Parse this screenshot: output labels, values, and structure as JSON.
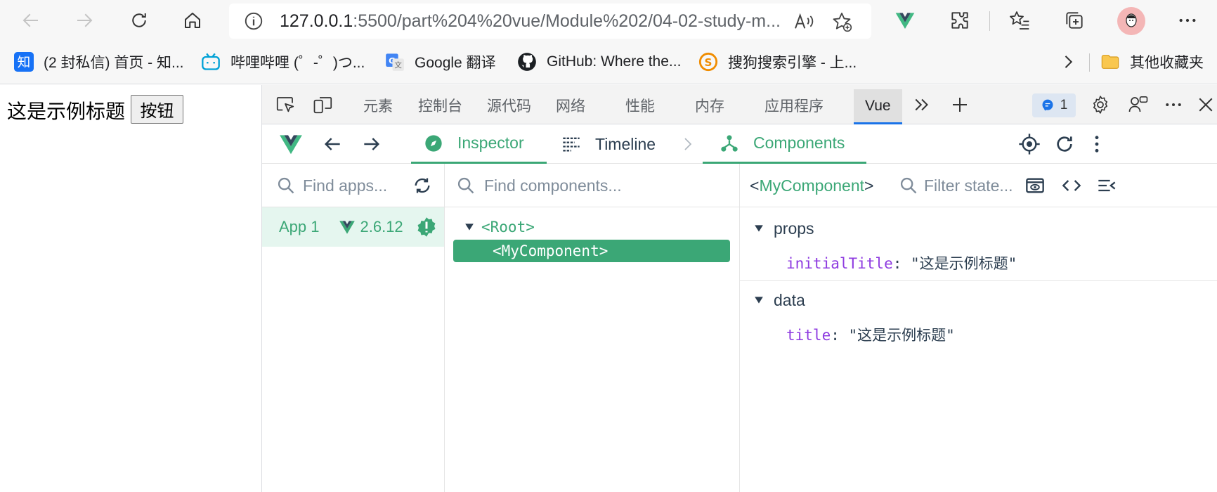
{
  "browser": {
    "url_host": "127.0.0.1",
    "url_rest": ":5500/part%204%20vue/Module%202/04-02-study-m...",
    "icons": {
      "back": "arrow-left-icon",
      "forward": "arrow-right-icon",
      "refresh": "refresh-icon",
      "home": "home-icon",
      "info": "info-icon",
      "read_aloud": "read-aloud-icon",
      "favorite": "star-plus-icon",
      "vue_ext": "vue-logo-icon",
      "extensions": "puzzle-icon",
      "favorites": "favorites-icon",
      "collections": "collections-icon",
      "profile": "avatar",
      "more": "more-icon"
    }
  },
  "bookmarks": [
    {
      "label": "(2 封私信) 首页 - 知...",
      "icon": "zhihu-icon"
    },
    {
      "label": "哔哩哔哩 (゜-゜)つ...",
      "icon": "bilibili-icon"
    },
    {
      "label": "Google 翻译",
      "icon": "google-translate-icon"
    },
    {
      "label": "GitHub: Where the...",
      "icon": "github-icon"
    },
    {
      "label": "搜狗搜索引擎 - 上...",
      "icon": "sogou-icon"
    }
  ],
  "bookmarks_other": "其他收藏夹",
  "page": {
    "title": "这是示例标题",
    "button": "按钮"
  },
  "devtools": {
    "tabs": [
      "元素",
      "控制台",
      "源代码",
      "网络",
      "性能",
      "内存",
      "应用程序",
      "Vue"
    ],
    "active_tab": "Vue",
    "issues_count": "1"
  },
  "vue": {
    "tabs": {
      "inspector": "Inspector",
      "timeline": "Timeline",
      "components": "Components"
    },
    "apps_search_placeholder": "Find apps...",
    "app": {
      "name": "App 1",
      "version": "2.6.12"
    },
    "components_search_placeholder": "Find components...",
    "tree": {
      "root": "<Root>",
      "selected": "<MyComponent>"
    },
    "inspector": {
      "component_prefix": "<",
      "component_name": "MyComponent",
      "component_suffix": ">",
      "filter_placeholder": "Filter state...",
      "sections": [
        {
          "name": "props",
          "key": "initialTitle",
          "value": "\"这是示例标题\""
        },
        {
          "name": "data",
          "key": "title",
          "value": "\"这是示例标题\""
        }
      ]
    }
  },
  "colors": {
    "vue_green": "#3ba776",
    "active_row_bg": "#e5f6ef",
    "prop_key": "#8e3be0",
    "edge_blue": "#1a73e8"
  }
}
